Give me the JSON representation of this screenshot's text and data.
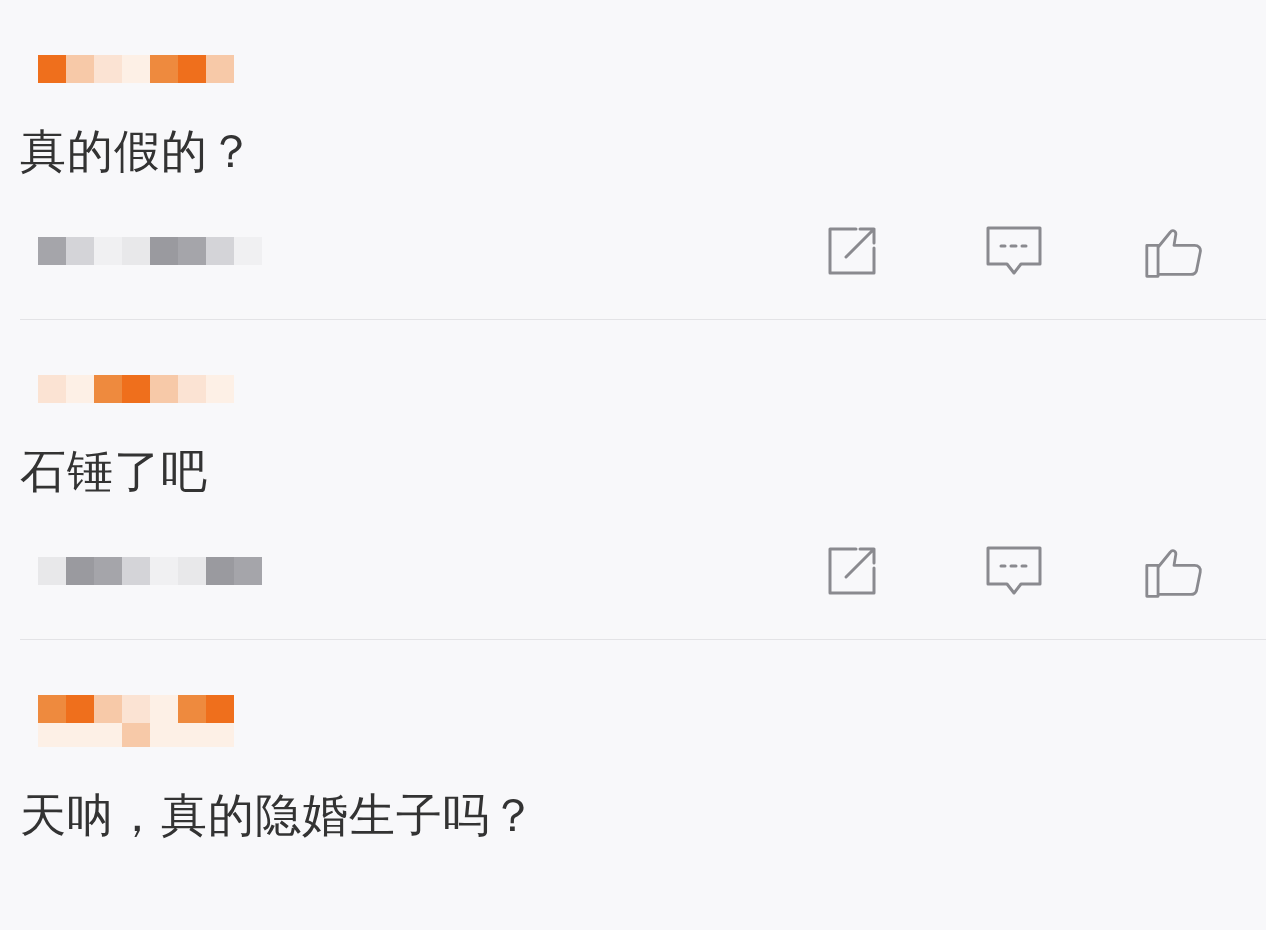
{
  "comments": [
    {
      "text": "真的假的？",
      "actions": true
    },
    {
      "text": "石锤了吧",
      "actions": true
    },
    {
      "text": "天呐，真的隐婚生子吗？",
      "actions": false
    }
  ]
}
